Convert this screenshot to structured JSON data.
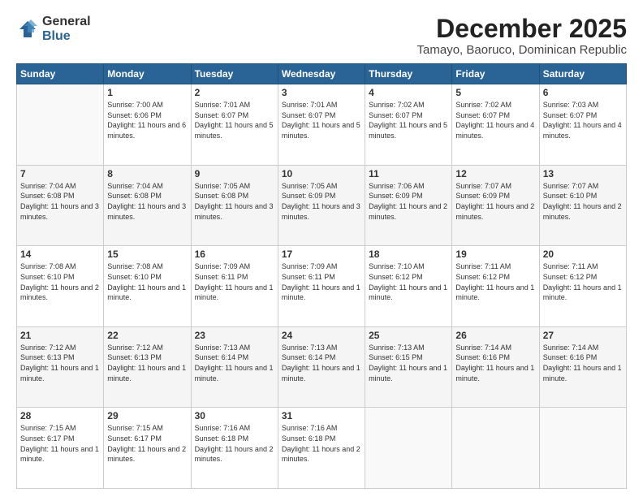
{
  "header": {
    "logo_general": "General",
    "logo_blue": "Blue",
    "month": "December 2025",
    "location": "Tamayo, Baoruco, Dominican Republic"
  },
  "days_of_week": [
    "Sunday",
    "Monday",
    "Tuesday",
    "Wednesday",
    "Thursday",
    "Friday",
    "Saturday"
  ],
  "weeks": [
    [
      {
        "num": "",
        "empty": true
      },
      {
        "num": "1",
        "sunrise": "7:00 AM",
        "sunset": "6:06 PM",
        "daylight": "11 hours and 6 minutes."
      },
      {
        "num": "2",
        "sunrise": "7:01 AM",
        "sunset": "6:07 PM",
        "daylight": "11 hours and 5 minutes."
      },
      {
        "num": "3",
        "sunrise": "7:01 AM",
        "sunset": "6:07 PM",
        "daylight": "11 hours and 5 minutes."
      },
      {
        "num": "4",
        "sunrise": "7:02 AM",
        "sunset": "6:07 PM",
        "daylight": "11 hours and 5 minutes."
      },
      {
        "num": "5",
        "sunrise": "7:02 AM",
        "sunset": "6:07 PM",
        "daylight": "11 hours and 4 minutes."
      },
      {
        "num": "6",
        "sunrise": "7:03 AM",
        "sunset": "6:07 PM",
        "daylight": "11 hours and 4 minutes."
      }
    ],
    [
      {
        "num": "7",
        "sunrise": "7:04 AM",
        "sunset": "6:08 PM",
        "daylight": "11 hours and 3 minutes."
      },
      {
        "num": "8",
        "sunrise": "7:04 AM",
        "sunset": "6:08 PM",
        "daylight": "11 hours and 3 minutes."
      },
      {
        "num": "9",
        "sunrise": "7:05 AM",
        "sunset": "6:08 PM",
        "daylight": "11 hours and 3 minutes."
      },
      {
        "num": "10",
        "sunrise": "7:05 AM",
        "sunset": "6:09 PM",
        "daylight": "11 hours and 3 minutes."
      },
      {
        "num": "11",
        "sunrise": "7:06 AM",
        "sunset": "6:09 PM",
        "daylight": "11 hours and 2 minutes."
      },
      {
        "num": "12",
        "sunrise": "7:07 AM",
        "sunset": "6:09 PM",
        "daylight": "11 hours and 2 minutes."
      },
      {
        "num": "13",
        "sunrise": "7:07 AM",
        "sunset": "6:10 PM",
        "daylight": "11 hours and 2 minutes."
      }
    ],
    [
      {
        "num": "14",
        "sunrise": "7:08 AM",
        "sunset": "6:10 PM",
        "daylight": "11 hours and 2 minutes."
      },
      {
        "num": "15",
        "sunrise": "7:08 AM",
        "sunset": "6:10 PM",
        "daylight": "11 hours and 1 minute."
      },
      {
        "num": "16",
        "sunrise": "7:09 AM",
        "sunset": "6:11 PM",
        "daylight": "11 hours and 1 minute."
      },
      {
        "num": "17",
        "sunrise": "7:09 AM",
        "sunset": "6:11 PM",
        "daylight": "11 hours and 1 minute."
      },
      {
        "num": "18",
        "sunrise": "7:10 AM",
        "sunset": "6:12 PM",
        "daylight": "11 hours and 1 minute."
      },
      {
        "num": "19",
        "sunrise": "7:11 AM",
        "sunset": "6:12 PM",
        "daylight": "11 hours and 1 minute."
      },
      {
        "num": "20",
        "sunrise": "7:11 AM",
        "sunset": "6:12 PM",
        "daylight": "11 hours and 1 minute."
      }
    ],
    [
      {
        "num": "21",
        "sunrise": "7:12 AM",
        "sunset": "6:13 PM",
        "daylight": "11 hours and 1 minute."
      },
      {
        "num": "22",
        "sunrise": "7:12 AM",
        "sunset": "6:13 PM",
        "daylight": "11 hours and 1 minute."
      },
      {
        "num": "23",
        "sunrise": "7:13 AM",
        "sunset": "6:14 PM",
        "daylight": "11 hours and 1 minute."
      },
      {
        "num": "24",
        "sunrise": "7:13 AM",
        "sunset": "6:14 PM",
        "daylight": "11 hours and 1 minute."
      },
      {
        "num": "25",
        "sunrise": "7:13 AM",
        "sunset": "6:15 PM",
        "daylight": "11 hours and 1 minute."
      },
      {
        "num": "26",
        "sunrise": "7:14 AM",
        "sunset": "6:16 PM",
        "daylight": "11 hours and 1 minute."
      },
      {
        "num": "27",
        "sunrise": "7:14 AM",
        "sunset": "6:16 PM",
        "daylight": "11 hours and 1 minute."
      }
    ],
    [
      {
        "num": "28",
        "sunrise": "7:15 AM",
        "sunset": "6:17 PM",
        "daylight": "11 hours and 1 minute."
      },
      {
        "num": "29",
        "sunrise": "7:15 AM",
        "sunset": "6:17 PM",
        "daylight": "11 hours and 2 minutes."
      },
      {
        "num": "30",
        "sunrise": "7:16 AM",
        "sunset": "6:18 PM",
        "daylight": "11 hours and 2 minutes."
      },
      {
        "num": "31",
        "sunrise": "7:16 AM",
        "sunset": "6:18 PM",
        "daylight": "11 hours and 2 minutes."
      },
      {
        "num": "",
        "empty": true
      },
      {
        "num": "",
        "empty": true
      },
      {
        "num": "",
        "empty": true
      }
    ]
  ],
  "labels": {
    "sunrise_prefix": "Sunrise: ",
    "sunset_prefix": "Sunset: ",
    "daylight_prefix": "Daylight: "
  }
}
